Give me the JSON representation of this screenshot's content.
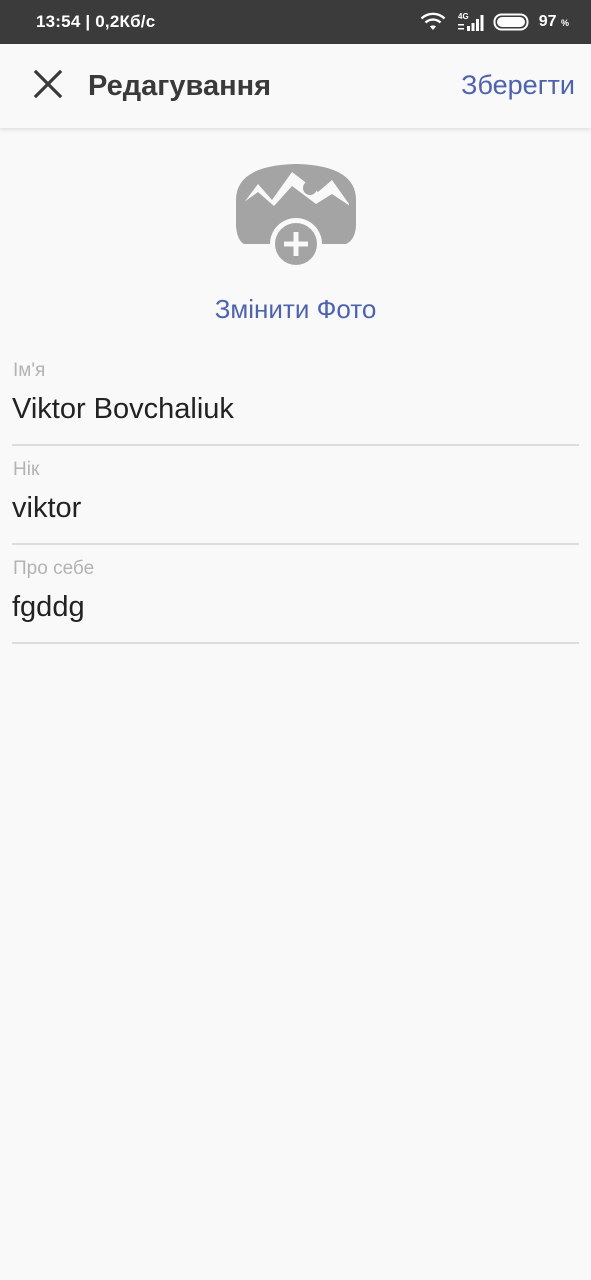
{
  "status_bar": {
    "time_speed": "13:54 | 0,2Кб/с",
    "network_type": "4G",
    "battery_percent": "97",
    "battery_unit": "%"
  },
  "app_bar": {
    "close_icon": "close-icon",
    "title": "Редагування",
    "save_label": "Зберегти"
  },
  "photo": {
    "icon": "add-photo-icon",
    "change_label": "Змінити Фото"
  },
  "fields": [
    {
      "label": "Ім'я",
      "value": "Viktor Bovchaliuk"
    },
    {
      "label": "Нік",
      "value": "viktor"
    },
    {
      "label": "Про себе",
      "value": "fgddg"
    }
  ],
  "colors": {
    "accent": "#4d63b0",
    "status_bar": "#3b3b3b",
    "background": "#f9f9f9"
  }
}
